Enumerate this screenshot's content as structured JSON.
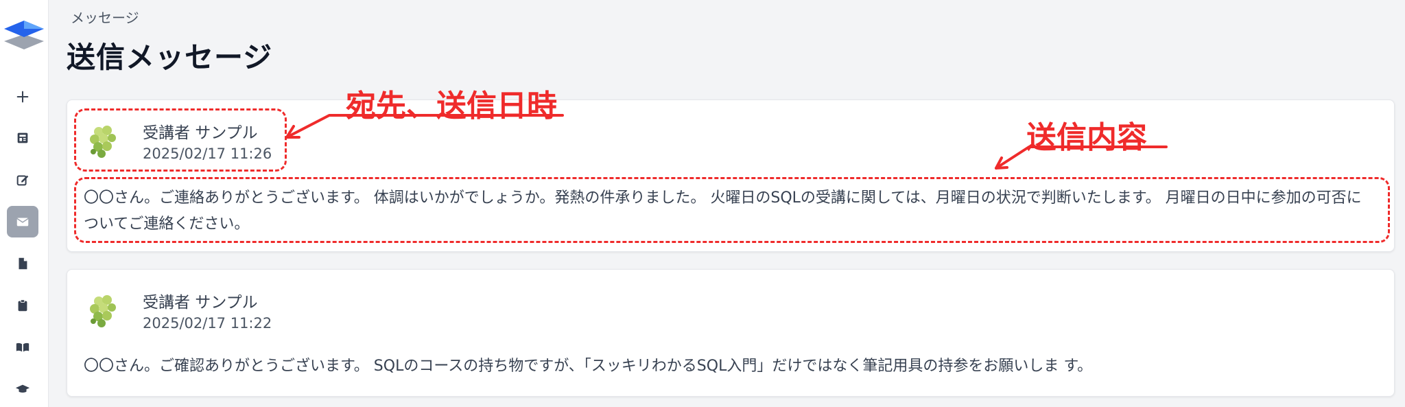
{
  "breadcrumb": "メッセージ",
  "page_title": "送信メッセージ",
  "messages": [
    {
      "sender": "受講者 サンプル",
      "timestamp": "2025/02/17 11:26",
      "body": "〇〇さん。ご連絡ありがとうございます。 体調はいかがでしょうか。発熱の件承りました。 火曜日のSQLの受講に関しては、月曜日の状況で判断いたします。 月曜日の日中に参加の可否についてご連絡ください。"
    },
    {
      "sender": "受講者 サンプル",
      "timestamp": "2025/02/17 11:22",
      "body": "〇〇さん。ご確認ありがとうございます。 SQLのコースの持ち物ですが、「スッキリわかるSQL入門」だけではなく筆記用具の持参をお願いしま す。"
    }
  ],
  "annotations": {
    "recipient_label": "宛先、送信日時",
    "content_label": "送信内容",
    "color": "#ef2b2b"
  },
  "sidebar": {
    "items": [
      {
        "icon": "plus-icon"
      },
      {
        "icon": "newspaper-icon"
      },
      {
        "icon": "edit-icon"
      },
      {
        "icon": "envelope-icon",
        "active": true
      },
      {
        "icon": "file-icon"
      },
      {
        "icon": "clipboard-icon"
      },
      {
        "icon": "book-icon"
      },
      {
        "icon": "graduation-cap-icon"
      }
    ]
  },
  "colors": {
    "active_nav_bg": "#9ca3af",
    "background": "#f3f4f6",
    "accent_annotation": "#ef2b2b"
  }
}
